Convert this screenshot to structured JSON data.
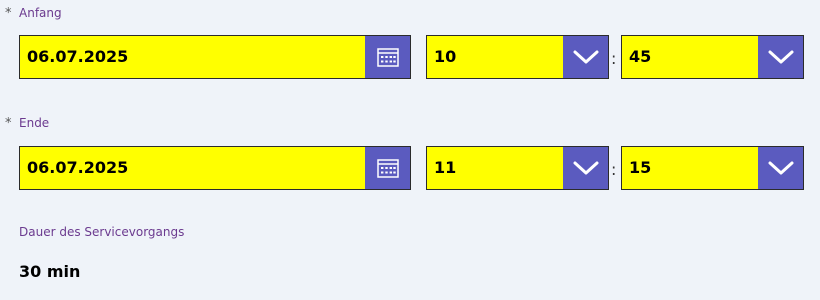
{
  "start": {
    "required_marker": "*",
    "label": "Anfang",
    "date": "06.07.2025",
    "hour": "10",
    "minute": "45",
    "separator": ":"
  },
  "end": {
    "required_marker": "*",
    "label": "Ende",
    "date": "06.07.2025",
    "hour": "11",
    "minute": "15",
    "separator": ":"
  },
  "duration": {
    "label": "Dauer des Servicevorgangs",
    "value": "30 min"
  },
  "colors": {
    "field_background": "#ffff00",
    "button_background": "#5b5bbf",
    "label_text": "#6b3a8f",
    "page_background": "#eff3f9"
  },
  "icons": {
    "calendar": "calendar-icon",
    "dropdown": "chevron-down-icon"
  }
}
